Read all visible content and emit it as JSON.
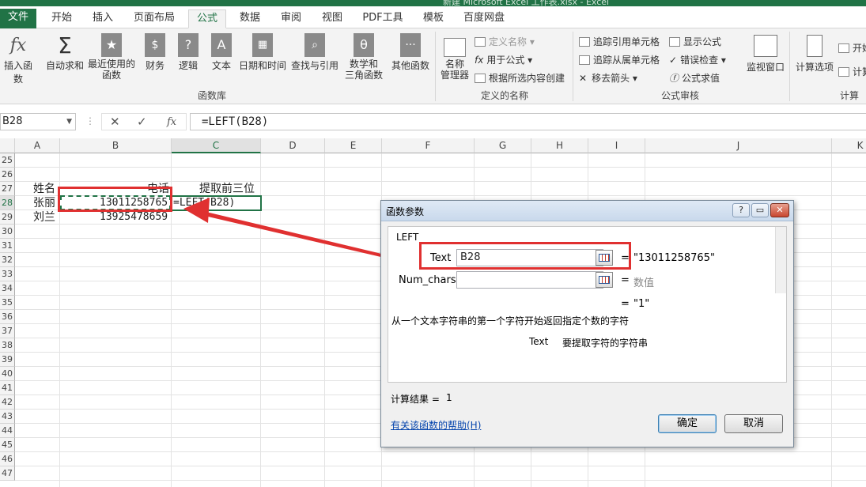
{
  "window": {
    "title": "新建 Microsoft Excel 工作表.xlsx - Excel"
  },
  "tabs": [
    "文件",
    "开始",
    "插入",
    "页面布局",
    "公式",
    "数据",
    "审阅",
    "视图",
    "PDF工具",
    "模板",
    "百度网盘"
  ],
  "ribbon": {
    "insert_function": "插入函数",
    "autosum": "自动求和",
    "recent_1": "最近使用的",
    "recent_2": "函数",
    "finance": "财务",
    "logic": "逻辑",
    "text": "文本",
    "datetime": "日期和时间",
    "lookup": "查找与引用",
    "math_1": "数学和",
    "math_2": "三角函数",
    "other": "其他函数",
    "library_label": "函数库",
    "name_mgr_1": "名称",
    "name_mgr_2": "管理器",
    "define_name": "定义名称",
    "use_in_formula": "用于公式",
    "create_from_sel": "根据所选内容创建",
    "defined_names_label": "定义的名称",
    "trace_precedents": "追踪引用单元格",
    "trace_dependents": "追踪从属单元格",
    "remove_arrows": "移去箭头",
    "show_formulas": "显示公式",
    "error_check": "错误检查",
    "eval_formula": "公式求值",
    "audit_label": "公式审核",
    "watch_window": "监视窗口",
    "calc_options": "计算选项",
    "calc_now": "开始",
    "calc_sheet": "计算",
    "calc_label": "计算"
  },
  "formula_bar": {
    "name_box": "B28",
    "formula": "=LEFT(B28)"
  },
  "columns": [
    "A",
    "B",
    "C",
    "D",
    "E",
    "F",
    "G",
    "H",
    "I",
    "J",
    "K"
  ],
  "rows": [
    "25",
    "26",
    "27",
    "28",
    "29",
    "30",
    "31",
    "32",
    "33",
    "34",
    "35",
    "36",
    "37",
    "38",
    "39",
    "40",
    "41",
    "42",
    "43",
    "44",
    "45",
    "46",
    "47"
  ],
  "cells": {
    "a27": "姓名",
    "b27": "电话",
    "c27": "提取前三位",
    "a28": "张丽",
    "b28": "13011258765",
    "c28": "=LEFT(B28)",
    "a29": "刘兰",
    "b29": "13925478659"
  },
  "dialog": {
    "title": "函数参数",
    "help_btn": "?",
    "min_btn": "▭",
    "close_btn": "✕",
    "func_name": "LEFT",
    "arg1_label": "Text",
    "arg1_value": "B28",
    "arg1_result": "\"13011258765\"",
    "arg2_label": "Num_chars",
    "arg2_value": "",
    "arg2_result": "数值",
    "eq": "=",
    "func_result": "\"1\"",
    "description": "从一个文本字符串的第一个字符开始返回指定个数的字符",
    "arg_help_name": "Text",
    "arg_help_text": "要提取字符的字符串",
    "calc_result_label": "计算结果 =",
    "calc_result_value": "1",
    "help_link": "有关该函数的帮助(H)",
    "ok": "确定",
    "cancel": "取消"
  },
  "colors": {
    "excel_green": "#217346",
    "highlight_red": "#e03030"
  }
}
